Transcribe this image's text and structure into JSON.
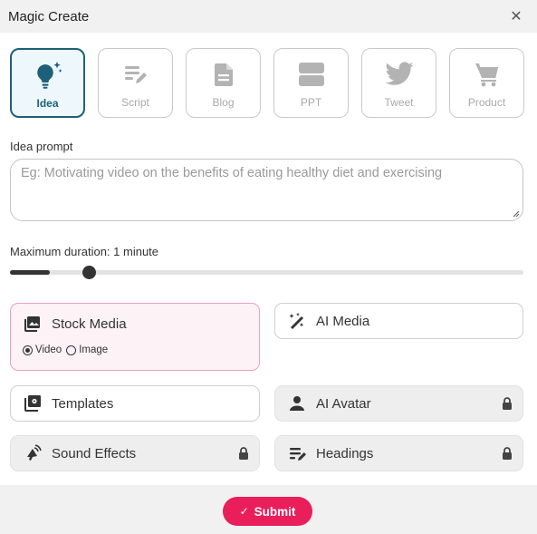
{
  "dialog": {
    "title": "Magic Create",
    "close_icon": "close-icon"
  },
  "types": [
    {
      "label": "Idea",
      "icon": "lightbulb-icon",
      "active": true
    },
    {
      "label": "Script",
      "icon": "script-icon",
      "active": false
    },
    {
      "label": "Blog",
      "icon": "document-icon",
      "active": false
    },
    {
      "label": "PPT",
      "icon": "slides-icon",
      "active": false
    },
    {
      "label": "Tweet",
      "icon": "twitter-icon",
      "active": false
    },
    {
      "label": "Product",
      "icon": "cart-icon",
      "active": false
    }
  ],
  "prompt": {
    "label": "Idea prompt",
    "placeholder": "Eg: Motivating video on the benefits of eating healthy diet and exercising",
    "value": ""
  },
  "duration": {
    "label": "Maximum duration: 1 minute",
    "level_fraction": 0.077
  },
  "options": {
    "stock_media": {
      "label": "Stock Media",
      "icon": "image-icon",
      "radio_video": "Video",
      "radio_image": "Image",
      "selected_radio": "Video"
    },
    "ai_media": {
      "label": "AI Media",
      "icon": "magic-wand-icon"
    },
    "templates": {
      "label": "Templates",
      "icon": "templates-icon"
    },
    "ai_avatar": {
      "label": "AI Avatar",
      "icon": "person-icon",
      "locked": true
    },
    "sound_effects": {
      "label": "Sound Effects",
      "icon": "speaker-icon",
      "locked": true
    },
    "headings": {
      "label": "Headings",
      "icon": "headings-icon",
      "locked": true
    }
  },
  "submit": {
    "label": "Submit",
    "icon": "check-icon"
  },
  "colors": {
    "accent": "#1e6079",
    "submit": "#e91e5a",
    "selected_bg": "#fdf2f5"
  }
}
